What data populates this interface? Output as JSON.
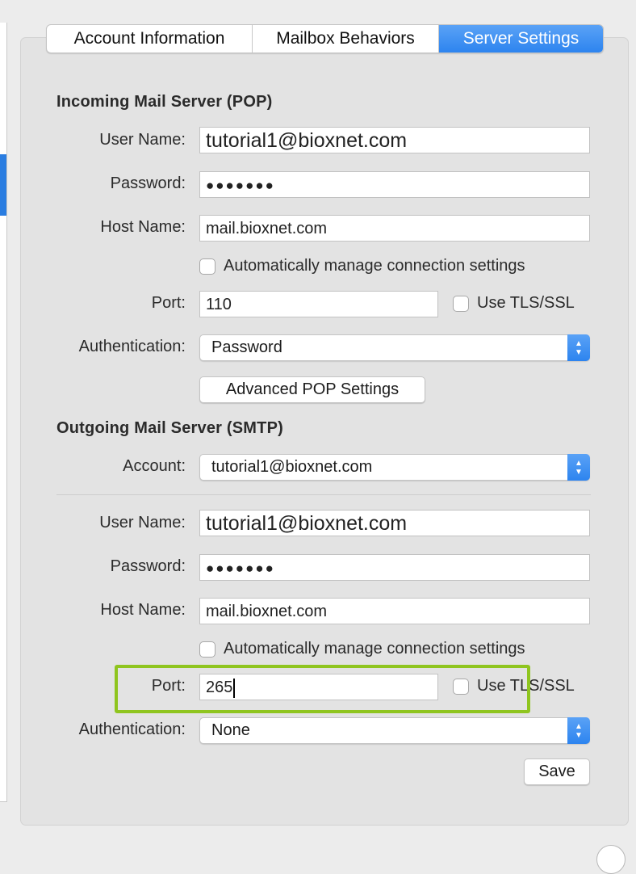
{
  "tabs": [
    {
      "label": "Account Information",
      "active": false
    },
    {
      "label": "Mailbox Behaviors",
      "active": false
    },
    {
      "label": "Server Settings",
      "active": true
    }
  ],
  "incoming": {
    "title": "Incoming Mail Server (POP)",
    "user_label": "User Name:",
    "user_value": "tutorial1@bioxnet.com",
    "password_label": "Password:",
    "password_value": "●●●●●●●",
    "host_label": "Host Name:",
    "host_value": "mail.bioxnet.com",
    "auto_label": "Automatically manage connection settings",
    "port_label": "Port:",
    "port_value": "110",
    "tls_label": "Use TLS/SSL",
    "auth_label": "Authentication:",
    "auth_value": "Password",
    "advanced_button": "Advanced POP Settings"
  },
  "outgoing": {
    "title": "Outgoing Mail Server (SMTP)",
    "account_label": "Account:",
    "account_value": "tutorial1@bioxnet.com",
    "user_label": "User Name:",
    "user_value": "tutorial1@bioxnet.com",
    "password_label": "Password:",
    "password_value": "●●●●●●●",
    "host_label": "Host Name:",
    "host_value": "mail.bioxnet.com",
    "auto_label": "Automatically manage connection settings",
    "port_label": "Port:",
    "port_value": "265",
    "tls_label": "Use TLS/SSL",
    "auth_label": "Authentication:",
    "auth_value": "None"
  },
  "save_button": "Save",
  "colors": {
    "accent": "#2d84ef",
    "highlight": "#8fc51f"
  }
}
